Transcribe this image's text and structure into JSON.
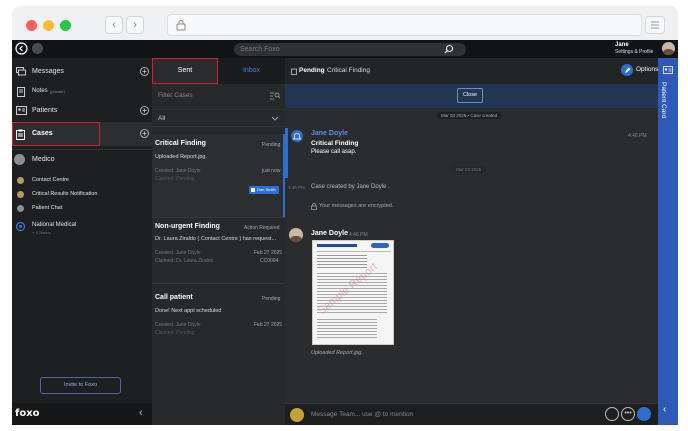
{
  "browser": {
    "back": "‹",
    "forward": "›"
  },
  "topbar": {
    "search_placeholder": "Search Foxo",
    "user_name": "Jane",
    "user_sub": "Settings & Profile"
  },
  "sidebar": {
    "items": [
      {
        "label": "Messages",
        "icon": "messages-icon"
      },
      {
        "label": "Notes",
        "sub": "(private)",
        "icon": "notes-icon"
      },
      {
        "label": "Patients",
        "icon": "patients-icon"
      },
      {
        "label": "Cases",
        "icon": "cases-icon"
      }
    ],
    "org": {
      "name": "Medico",
      "subitems": [
        "Contact Centre",
        "Critical Results Notification",
        "Patient Chat"
      ]
    },
    "org2": {
      "name": "National Medical",
      "sub": "+ 3 Teams"
    },
    "invite": "Invite to Foxo",
    "logo": "foxo",
    "collapse": "‹"
  },
  "cases": {
    "tabs": [
      "Sent",
      "Inbox"
    ],
    "filter_placeholder": "Filter Cases",
    "filter_value": "All",
    "list": [
      {
        "title": "Critical Finding",
        "status": "Pending",
        "preview": "Uploaded Report.jpg.",
        "created": "Created: Jane Doyle",
        "time": "just now",
        "claimed": "Claimed: Pending",
        "tag": "Dan Smith"
      },
      {
        "title": "Non-urgent Finding",
        "status": "Action Required",
        "preview": "Dr. Laura Ziraldo ( Contact Centre ) has request...",
        "created": "Created: Jane Doyle",
        "time": "Feb 27 2025",
        "claimed": "Claimed: Dr. Laura Ziraldo",
        "code": "CC0004"
      },
      {
        "title": "Call patient",
        "status": "Pending",
        "preview": "Done! Next appt scheduled",
        "created": "Created: Jane Doyle",
        "time": "Feb 27 2025",
        "claimed": "Claimed: Pending"
      }
    ]
  },
  "chat": {
    "header_status": "Pending",
    "header_title": "Critical Finding",
    "options": "Options",
    "close_button": "Close",
    "date_banner": "Mar 03 2025 • Case created",
    "msg1": {
      "sender": "Jane Doyle",
      "title": "Critical Finding",
      "body": "Please call asap.",
      "time": "4:46 PM"
    },
    "date_pill": "Mar 03 2025",
    "system": {
      "time": "4:46 PM",
      "text": "Case created by Jane Doyle ."
    },
    "encrypted": "Your messages are encrypted.",
    "msg2": {
      "sender": "Jane Doyle",
      "time": "4:46 PM",
      "attachment_caption": "Uploaded Report.jpg.",
      "watermark": "Sample Report"
    },
    "composer_placeholder": "Message Team... use @ to mention"
  },
  "patient_card": {
    "label": "Patient Card"
  },
  "colors": {
    "accent": "#2d6fd1",
    "red_highlight": "#d2232a",
    "background": "#232527"
  }
}
